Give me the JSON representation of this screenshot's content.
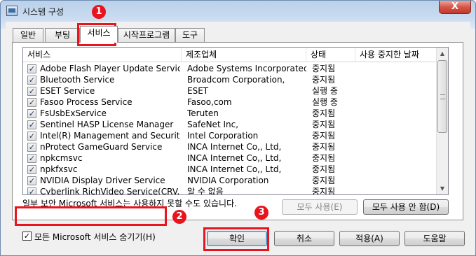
{
  "window": {
    "title": "시스템 구성",
    "close_symbol": "X"
  },
  "tabs": [
    "일반",
    "부팅",
    "서비스",
    "시작프로그램",
    "도구"
  ],
  "active_tab": "서비스",
  "columns": [
    "서비스",
    "제조업체",
    "상태",
    "사용 중지한 날짜"
  ],
  "services": [
    {
      "name": "Adobe Flash Player Update Service",
      "maker": "Adobe Systems Incorporated",
      "status": "중지됨",
      "checked": true
    },
    {
      "name": "Bluetooth Service",
      "maker": "Broadcom Corporation,",
      "status": "중지됨",
      "checked": true
    },
    {
      "name": "ESET Service",
      "maker": "ESET",
      "status": "실행 중",
      "checked": true
    },
    {
      "name": "Fasoo Process Service",
      "maker": "Fasoo,com",
      "status": "실행 중",
      "checked": true
    },
    {
      "name": "FsUsbExService",
      "maker": "Teruten",
      "status": "중지됨",
      "checked": true
    },
    {
      "name": "Sentinel HASP License Manager",
      "maker": "SafeNet Inc,",
      "status": "중지됨",
      "checked": true
    },
    {
      "name": "Intel(R) Management and Securit,,,",
      "maker": "Intel Corporation",
      "status": "중지됨",
      "checked": true
    },
    {
      "name": "nProtect GameGuard Service",
      "maker": "INCA Internet Co,, Ltd,",
      "status": "중지됨",
      "checked": true
    },
    {
      "name": "npkcmsvc",
      "maker": "INCA Internet Co,, Ltd,",
      "status": "중지됨",
      "checked": true
    },
    {
      "name": "npkfxsvc",
      "maker": "INCA Internet Co,, Ltd,",
      "status": "중지됨",
      "checked": true
    },
    {
      "name": "NVIDIA Display Driver Service",
      "maker": "NVIDIA Corporation",
      "status": "중지됨",
      "checked": true
    },
    {
      "name": "Cyberlink RichVideo Service(CRV...",
      "maker": "알 수 없음",
      "status": "중지됨",
      "checked": true
    }
  ],
  "note": "일부 보안 Microsoft 서비스는 사용하지 못할 수도 있습니다.",
  "enable_all": "모두 사용(E)",
  "disable_all": "모두 사용 안 함(D)",
  "hide_ms": {
    "label": "모든 Microsoft 서비스 숨기기(H)",
    "checked": true
  },
  "buttons": {
    "ok": "확인",
    "cancel": "취소",
    "apply": "적용(A)",
    "help": "도움말"
  },
  "scrollbar": {
    "up_icon": "up-arrow",
    "down_icon": "down-arrow"
  },
  "annotations": {
    "marker_color": "#e8141e",
    "steps": [
      "1",
      "2",
      "3"
    ]
  }
}
